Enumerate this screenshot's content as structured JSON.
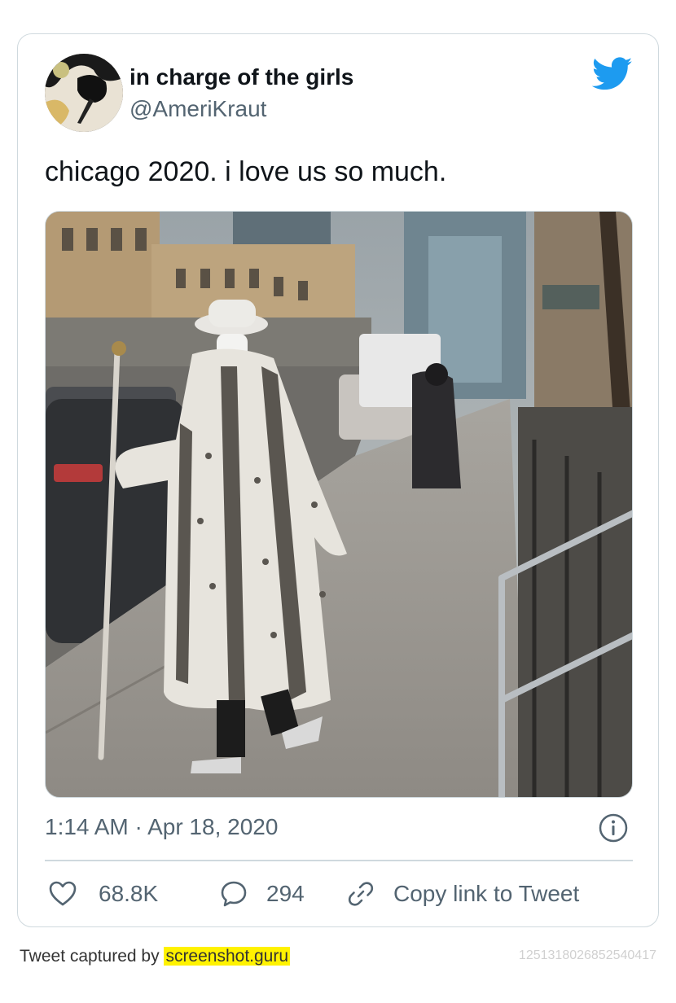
{
  "tweet": {
    "display_name": "in charge of the girls",
    "handle": "@AmeriKraut",
    "text": "chicago 2020. i love us so much.",
    "timestamp": "1:14 AM · Apr 18, 2020",
    "likes": "68.8K",
    "replies": "294",
    "copy_link_label": "Copy link to Tweet"
  },
  "footer": {
    "captured_prefix": "Tweet captured by ",
    "captured_site": "screenshot.guru",
    "tweet_id": "1251318026852540417"
  },
  "icons": {
    "brand": "twitter-bird-icon",
    "info": "info-icon",
    "like": "heart-icon",
    "reply": "reply-bubble-icon",
    "link": "link-icon"
  },
  "colors": {
    "brand_blue": "#1d9bf0",
    "secondary_text": "#536471",
    "border": "#cfd9de",
    "highlight": "#fff200"
  }
}
